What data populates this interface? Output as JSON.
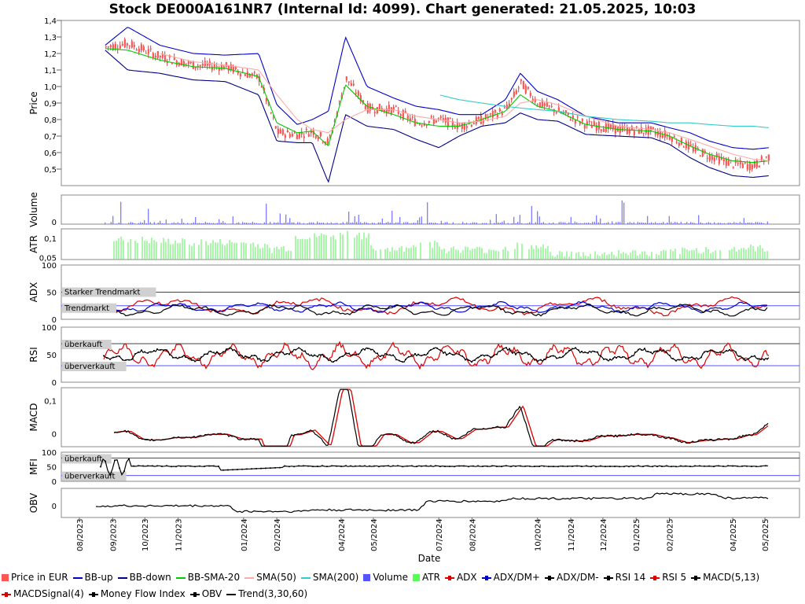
{
  "title": "Stock DE000A161NR7 (Internal Id: 4099). Chart generated: 21.05.2025, 10:03",
  "xlabel": "Date",
  "chart_data": [
    {
      "type": "line",
      "panel": "price",
      "ylabel": "Price",
      "ylim": [
        0.4,
        1.4
      ],
      "yticks": [
        "0,5",
        "0,6",
        "0,7",
        "0,8",
        "0,9",
        "1,0",
        "1,1",
        "1,2",
        "1,3",
        "1,4"
      ],
      "x": [
        "2023-08-25",
        "2023-09-15",
        "2023-10-15",
        "2023-11-15",
        "2023-12-15",
        "2024-01-15",
        "2024-02-01",
        "2024-02-20",
        "2024-03-05",
        "2024-03-20",
        "2024-04-05",
        "2024-04-25",
        "2024-05-20",
        "2024-06-10",
        "2024-07-01",
        "2024-07-20",
        "2024-08-10",
        "2024-09-01",
        "2024-09-15",
        "2024-10-01",
        "2024-10-20",
        "2024-11-15",
        "2024-12-15",
        "2025-01-15",
        "2025-02-01",
        "2025-02-20",
        "2025-03-10",
        "2025-04-01",
        "2025-04-20",
        "2025-05-05"
      ],
      "series": [
        {
          "name": "Price in EUR",
          "values": [
            1.24,
            1.26,
            1.18,
            1.13,
            1.12,
            1.05,
            0.72,
            0.71,
            0.73,
            0.66,
            1.05,
            0.87,
            0.86,
            0.78,
            0.8,
            0.76,
            0.8,
            0.86,
            1.02,
            0.9,
            0.85,
            0.77,
            0.74,
            0.73,
            0.7,
            0.63,
            0.58,
            0.53,
            0.52,
            0.58
          ]
        },
        {
          "name": "BB-up",
          "values": [
            1.25,
            1.36,
            1.25,
            1.2,
            1.19,
            1.2,
            0.89,
            0.77,
            0.8,
            0.85,
            1.3,
            1.0,
            0.93,
            0.88,
            0.86,
            0.83,
            0.83,
            0.92,
            1.08,
            0.97,
            0.92,
            0.82,
            0.78,
            0.78,
            0.75,
            0.72,
            0.67,
            0.63,
            0.62,
            0.63
          ]
        },
        {
          "name": "BB-down",
          "values": [
            1.22,
            1.1,
            1.08,
            1.04,
            1.03,
            0.95,
            0.67,
            0.66,
            0.66,
            0.42,
            0.83,
            0.76,
            0.74,
            0.68,
            0.63,
            0.7,
            0.76,
            0.78,
            0.84,
            0.8,
            0.79,
            0.71,
            0.7,
            0.69,
            0.65,
            0.57,
            0.51,
            0.46,
            0.45,
            0.46
          ]
        },
        {
          "name": "BB-SMA-20",
          "values": [
            1.23,
            1.22,
            1.16,
            1.12,
            1.11,
            1.06,
            0.78,
            0.72,
            0.73,
            0.64,
            1.01,
            0.88,
            0.83,
            0.78,
            0.76,
            0.76,
            0.8,
            0.85,
            0.95,
            0.88,
            0.85,
            0.77,
            0.74,
            0.73,
            0.7,
            0.64,
            0.59,
            0.55,
            0.54,
            0.55
          ]
        },
        {
          "name": "SMA(50)",
          "values": [
            null,
            null,
            1.2,
            1.15,
            1.13,
            1.1,
            0.95,
            0.8,
            0.74,
            0.72,
            0.8,
            0.86,
            0.86,
            0.82,
            0.8,
            0.78,
            0.79,
            0.82,
            0.9,
            0.92,
            0.89,
            0.82,
            0.76,
            0.74,
            0.72,
            0.68,
            0.64,
            0.59,
            0.56,
            0.55
          ]
        },
        {
          "name": "SMA(200)",
          "values": [
            null,
            null,
            null,
            null,
            null,
            null,
            null,
            null,
            null,
            null,
            null,
            null,
            null,
            null,
            0.95,
            0.92,
            0.9,
            0.88,
            0.87,
            0.86,
            0.85,
            0.82,
            0.8,
            0.79,
            0.78,
            0.78,
            0.77,
            0.76,
            0.76,
            0.75
          ]
        }
      ]
    },
    {
      "type": "bar",
      "panel": "volume",
      "ylabel": "Volume",
      "yticks": [
        "0"
      ],
      "series": [
        {
          "name": "Volume"
        }
      ]
    },
    {
      "type": "bar",
      "panel": "atr",
      "ylabel": "ATR",
      "yticks": [
        "0,05",
        "0,1"
      ],
      "ylim": [
        0.045,
        0.125
      ],
      "series": [
        {
          "name": "ATR"
        }
      ]
    },
    {
      "type": "line",
      "panel": "adx",
      "ylabel": "ADX",
      "ylim": [
        0,
        100
      ],
      "yticks": [
        "0",
        "50",
        "100"
      ],
      "annotations": [
        "Starker Trendmarkt",
        "Trendmarkt"
      ],
      "series": [
        {
          "name": "ADX"
        },
        {
          "name": "ADX/DM+"
        },
        {
          "name": "ADX/DM-"
        }
      ]
    },
    {
      "type": "line",
      "panel": "rsi",
      "ylabel": "RSI",
      "ylim": [
        0,
        100
      ],
      "yticks": [
        "0",
        "50",
        "100"
      ],
      "annotations": [
        "überkauft",
        "überverkauft"
      ],
      "series": [
        {
          "name": "RSI 14"
        },
        {
          "name": "RSI 5"
        }
      ]
    },
    {
      "type": "line",
      "panel": "macd",
      "ylabel": "MACD",
      "yticks": [
        "0",
        "0,1"
      ],
      "series": [
        {
          "name": "MACD(5,13)"
        },
        {
          "name": "MACDSignal(4)"
        }
      ]
    },
    {
      "type": "line",
      "panel": "mfi",
      "ylabel": "MFI",
      "ylim": [
        0,
        100
      ],
      "yticks": [
        "0",
        "50",
        "100"
      ],
      "annotations": [
        "überkauft",
        "überverkauft"
      ],
      "series": [
        {
          "name": "Money Flow Index"
        }
      ]
    },
    {
      "type": "line",
      "panel": "obv",
      "ylabel": "OBV",
      "yticks": [
        "0"
      ],
      "series": [
        {
          "name": "OBV"
        },
        {
          "name": "Trend(3,30,60)"
        }
      ]
    }
  ],
  "xticks": [
    "08/2023",
    "09/2023",
    "10/2023",
    "11/2023",
    "01/2024",
    "02/2024",
    "04/2024",
    "05/2024",
    "07/2024",
    "08/2024",
    "10/2024",
    "11/2024",
    "12/2024",
    "01/2025",
    "02/2025",
    "04/2025",
    "05/2025"
  ],
  "legend": [
    {
      "label": "Price in EUR",
      "color": "#ff5555",
      "kind": "square"
    },
    {
      "label": "BB-up",
      "color": "#0000cc",
      "kind": "line"
    },
    {
      "label": "BB-down",
      "color": "#000088",
      "kind": "line"
    },
    {
      "label": "BB-SMA-20",
      "color": "#00cc00",
      "kind": "line"
    },
    {
      "label": "SMA(50)",
      "color": "#ffaaaa",
      "kind": "line"
    },
    {
      "label": "SMA(200)",
      "color": "#33cccc",
      "kind": "line"
    },
    {
      "label": "Volume",
      "color": "#5555ff",
      "kind": "square"
    },
    {
      "label": "ATR",
      "color": "#55ff55",
      "kind": "square"
    },
    {
      "label": "ADX",
      "color": "#dd0000",
      "kind": "dotline"
    },
    {
      "label": "ADX/DM+",
      "color": "#0000cc",
      "kind": "dotline"
    },
    {
      "label": "ADX/DM-",
      "color": "#000000",
      "kind": "dotline"
    },
    {
      "label": "RSI 14",
      "color": "#000000",
      "kind": "dotline"
    },
    {
      "label": "RSI 5",
      "color": "#dd0000",
      "kind": "dotline"
    },
    {
      "label": "MACD(5,13)",
      "color": "#000000",
      "kind": "dotline"
    },
    {
      "label": "MACDSignal(4)",
      "color": "#dd0000",
      "kind": "dotline"
    },
    {
      "label": "Money Flow Index",
      "color": "#000000",
      "kind": "dotline"
    },
    {
      "label": "OBV",
      "color": "#000000",
      "kind": "dotline"
    },
    {
      "label": "Trend(3,30,60)",
      "color": "#000000",
      "kind": "line"
    }
  ]
}
